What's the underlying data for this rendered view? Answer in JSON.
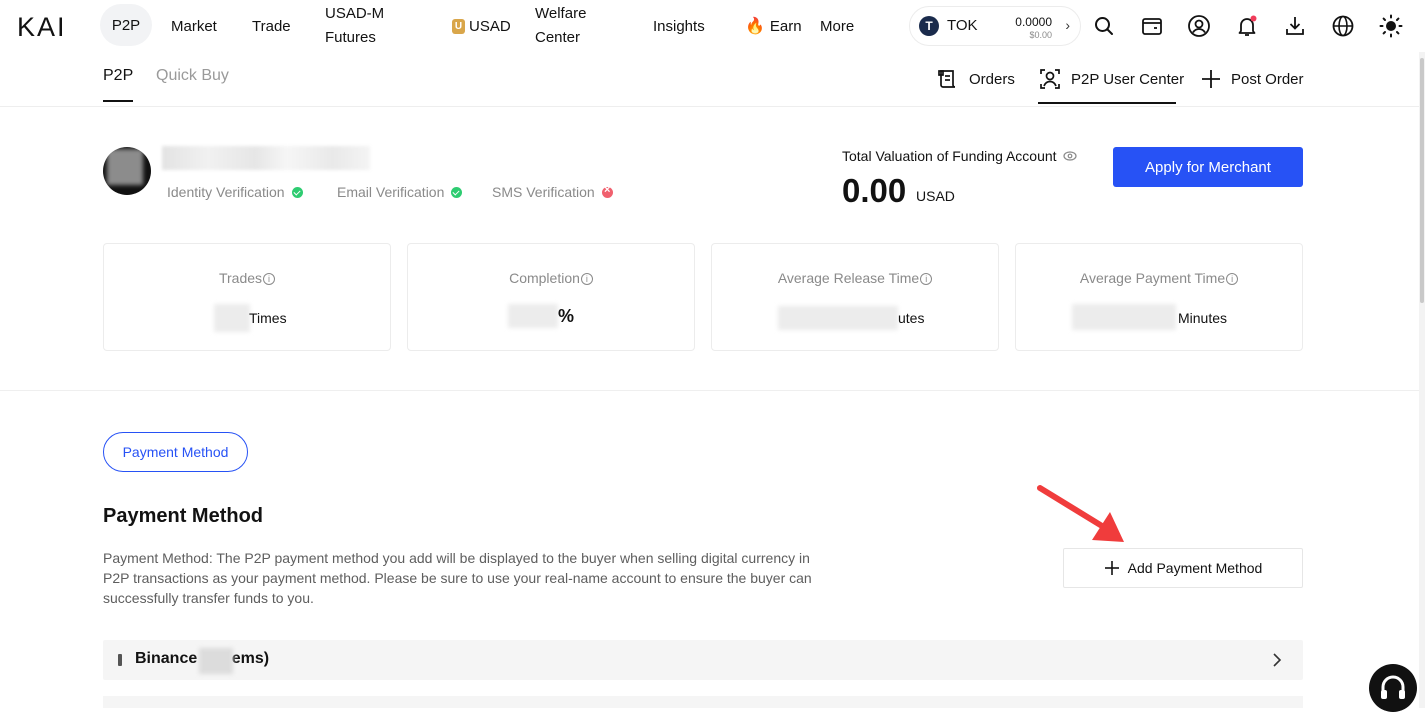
{
  "nav": {
    "logo": "KAI",
    "items": [
      "P2P",
      "Market",
      "Trade",
      "USAD-M Futures",
      "USAD",
      "Welfare Center",
      "Insights",
      "Earn",
      "More"
    ],
    "usad_l1": "USAD-M",
    "usad_l2": "Futures",
    "welfare_l1": "Welfare",
    "welfare_l2": "Center",
    "usad_coin": "U",
    "tok": {
      "symbol": "TOK",
      "value": "0.0000",
      "usd": "$0.00"
    }
  },
  "subnav": {
    "tabs": [
      "P2P",
      "Quick Buy"
    ],
    "orders": "Orders",
    "user_center": "P2P User Center",
    "post_order": "Post Order"
  },
  "profile": {
    "verifications": [
      "Identity Verification",
      "Email Verification",
      "SMS Verification"
    ],
    "verification_status": [
      "verified",
      "verified",
      "unverified"
    ],
    "valuation_label": "Total Valuation of Funding Account",
    "valuation_amount": "0.00",
    "valuation_unit": "USAD",
    "apply_button": "Apply for Merchant"
  },
  "stats": [
    {
      "label": "Trades",
      "value_suffix": "Times"
    },
    {
      "label": "Completion",
      "value_suffix": "%"
    },
    {
      "label": "Average Release Time",
      "value_suffix": "utes"
    },
    {
      "label": "Average Payment Time",
      "value_suffix": "Minutes"
    }
  ],
  "payment": {
    "tab_label": "Payment Method",
    "title": "Payment Method",
    "description": "Payment Method: The P2P payment method you add will be displayed to the buyer when selling digital currency in P2P transactions as your payment method. Please be sure to use your real-name account to ensure the buyer can successfully transfer funds to you.",
    "add_button": "Add Payment Method",
    "rows": [
      {
        "label_start": "Binance",
        "label_end": "ems)"
      }
    ]
  },
  "colors": {
    "accent": "#2752f5",
    "success": "#2ecc71",
    "error": "#f0606e",
    "annotation_arrow": "#f03c3c"
  }
}
